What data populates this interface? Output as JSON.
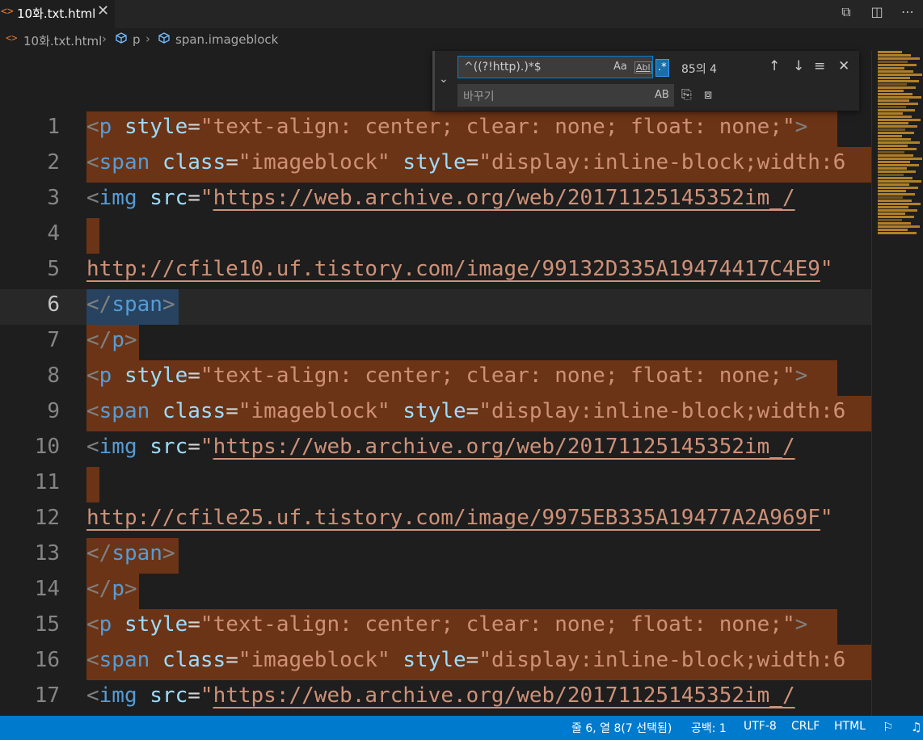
{
  "tab": {
    "icon": "html-file-icon",
    "title": "10화.txt.html",
    "close": "✕"
  },
  "breadcrumb": {
    "file": "10화.txt.html",
    "sym1": "p",
    "sym2": "span.imageblock"
  },
  "find": {
    "query": "^((?!http).)*$",
    "match_case": "Aa",
    "whole_word": "Abl",
    "regex": ".*",
    "result": "85의 4",
    "replace_placeholder": "바꾸기",
    "preserve_case": "AB"
  },
  "lines": [
    {
      "n": "1",
      "hl": true,
      "parts": [
        [
          "br",
          "<"
        ],
        [
          "tag",
          "p"
        ],
        [
          "sp",
          " "
        ],
        [
          "attr",
          "style"
        ],
        [
          "eq",
          "="
        ],
        [
          "str",
          "\"text-align: center; clear: none; float: none;\""
        ],
        [
          "br",
          ">"
        ]
      ]
    },
    {
      "n": "2",
      "hl": true,
      "parts": [
        [
          "br",
          "<"
        ],
        [
          "tag",
          "span"
        ],
        [
          "sp",
          " "
        ],
        [
          "attr",
          "class"
        ],
        [
          "eq",
          "="
        ],
        [
          "str",
          "\"imageblock\""
        ],
        [
          "sp",
          " "
        ],
        [
          "attr",
          "style"
        ],
        [
          "eq",
          "="
        ],
        [
          "str",
          "\"display:inline-block;width:6"
        ]
      ]
    },
    {
      "n": "3",
      "hl": false,
      "parts": [
        [
          "br",
          "<"
        ],
        [
          "tag",
          "img"
        ],
        [
          "sp",
          " "
        ],
        [
          "attr",
          "src"
        ],
        [
          "eq",
          "="
        ],
        [
          "str",
          "\""
        ],
        [
          "url",
          "https://web.archive.org/web/20171125145352im_/"
        ]
      ]
    },
    {
      "n": "4",
      "hl": true,
      "small": true,
      "parts": []
    },
    {
      "n": "5",
      "hl": false,
      "parts": [
        [
          "url",
          "http://cfile10.uf.tistory.com/image/99132D335A19474417C4E9"
        ],
        [
          "str",
          "\""
        ]
      ]
    },
    {
      "n": "6",
      "sel": true,
      "current": true,
      "parts": [
        [
          "br",
          "</"
        ],
        [
          "tag",
          "span"
        ],
        [
          "br",
          ">"
        ]
      ]
    },
    {
      "n": "7",
      "hl": true,
      "parts": [
        [
          "br",
          "</"
        ],
        [
          "tag",
          "p"
        ],
        [
          "br",
          ">"
        ]
      ]
    },
    {
      "n": "8",
      "hl": true,
      "parts": [
        [
          "br",
          "<"
        ],
        [
          "tag",
          "p"
        ],
        [
          "sp",
          " "
        ],
        [
          "attr",
          "style"
        ],
        [
          "eq",
          "="
        ],
        [
          "str",
          "\"text-align: center; clear: none; float: none;\""
        ],
        [
          "br",
          ">"
        ]
      ]
    },
    {
      "n": "9",
      "hl": true,
      "parts": [
        [
          "br",
          "<"
        ],
        [
          "tag",
          "span"
        ],
        [
          "sp",
          " "
        ],
        [
          "attr",
          "class"
        ],
        [
          "eq",
          "="
        ],
        [
          "str",
          "\"imageblock\""
        ],
        [
          "sp",
          " "
        ],
        [
          "attr",
          "style"
        ],
        [
          "eq",
          "="
        ],
        [
          "str",
          "\"display:inline-block;width:6"
        ]
      ]
    },
    {
      "n": "10",
      "hl": false,
      "parts": [
        [
          "br",
          "<"
        ],
        [
          "tag",
          "img"
        ],
        [
          "sp",
          " "
        ],
        [
          "attr",
          "src"
        ],
        [
          "eq",
          "="
        ],
        [
          "str",
          "\""
        ],
        [
          "url",
          "https://web.archive.org/web/20171125145352im_/"
        ]
      ]
    },
    {
      "n": "11",
      "hl": true,
      "small": true,
      "parts": []
    },
    {
      "n": "12",
      "hl": false,
      "parts": [
        [
          "url",
          "http://cfile25.uf.tistory.com/image/9975EB335A19477A2A969F"
        ],
        [
          "str",
          "\""
        ]
      ]
    },
    {
      "n": "13",
      "hl": true,
      "parts": [
        [
          "br",
          "</"
        ],
        [
          "tag",
          "span"
        ],
        [
          "br",
          ">"
        ]
      ]
    },
    {
      "n": "14",
      "hl": true,
      "parts": [
        [
          "br",
          "</"
        ],
        [
          "tag",
          "p"
        ],
        [
          "br",
          ">"
        ]
      ]
    },
    {
      "n": "15",
      "hl": true,
      "parts": [
        [
          "br",
          "<"
        ],
        [
          "tag",
          "p"
        ],
        [
          "sp",
          " "
        ],
        [
          "attr",
          "style"
        ],
        [
          "eq",
          "="
        ],
        [
          "str",
          "\"text-align: center; clear: none; float: none;\""
        ],
        [
          "br",
          ">"
        ]
      ]
    },
    {
      "n": "16",
      "hl": true,
      "parts": [
        [
          "br",
          "<"
        ],
        [
          "tag",
          "span"
        ],
        [
          "sp",
          " "
        ],
        [
          "attr",
          "class"
        ],
        [
          "eq",
          "="
        ],
        [
          "str",
          "\"imageblock\""
        ],
        [
          "sp",
          " "
        ],
        [
          "attr",
          "style"
        ],
        [
          "eq",
          "="
        ],
        [
          "str",
          "\"display:inline-block;width:6"
        ]
      ]
    },
    {
      "n": "17",
      "hl": false,
      "parts": [
        [
          "br",
          "<"
        ],
        [
          "tag",
          "img"
        ],
        [
          "sp",
          " "
        ],
        [
          "attr",
          "src"
        ],
        [
          "eq",
          "="
        ],
        [
          "str",
          "\""
        ],
        [
          "url",
          "https://web.archive.org/web/20171125145352im_/"
        ]
      ]
    }
  ],
  "status": {
    "position": "줄 6, 열 8(7 선택됨)",
    "indent": "공백: 1",
    "encoding": "UTF-8",
    "eol": "CRLF",
    "language": "HTML"
  },
  "colors": {
    "accent": "#007acc",
    "match_highlight": "#6b3416"
  }
}
